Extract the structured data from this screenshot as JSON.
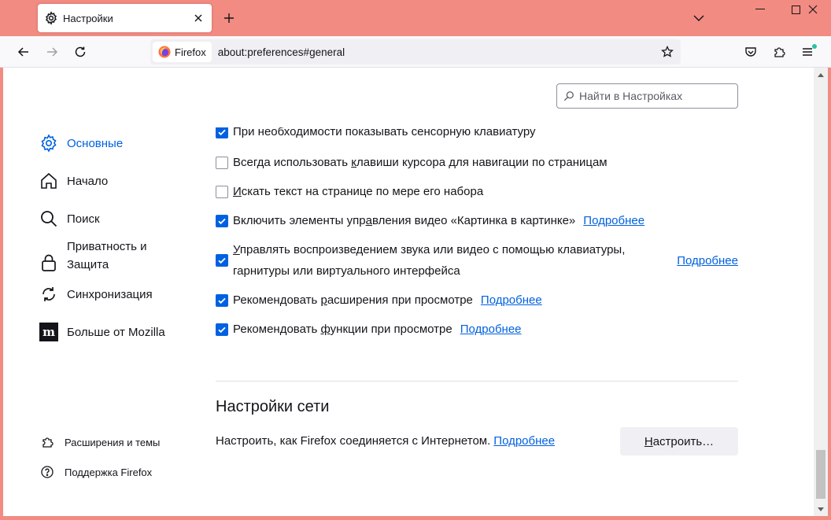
{
  "window": {
    "tab_title": "Настройки",
    "colors": {
      "frame": "#f28b82",
      "accent": "#0061e0"
    }
  },
  "toolbar": {
    "identity_label": "Firefox",
    "url": "about:preferences#general"
  },
  "search": {
    "placeholder": "Найти в Настройках"
  },
  "sidebar": {
    "categories": [
      {
        "label": "Основные",
        "icon": "gear-icon",
        "selected": true
      },
      {
        "label": "Начало",
        "icon": "home-icon"
      },
      {
        "label": "Поиск",
        "icon": "search-icon"
      },
      {
        "label": "Приватность и",
        "label2": "Защита",
        "icon": "lock-icon"
      },
      {
        "label": "Синхронизация",
        "icon": "sync-icon"
      },
      {
        "label": "Больше от Mozilla",
        "icon": "mozilla-icon"
      }
    ],
    "footer": [
      {
        "label": "Расширения и темы",
        "icon": "puzzle-icon"
      },
      {
        "label": "Поддержка Firefox",
        "icon": "help-icon"
      }
    ]
  },
  "options": [
    {
      "pre": "",
      "ak": "",
      "post": "При необходимости показывать сенсорную клавиатуру",
      "checked": true
    },
    {
      "pre": "Всегда использовать ",
      "ak": "к",
      "post": "лавиши курсора для навигации по страницам",
      "checked": false
    },
    {
      "pre": "",
      "ak": "И",
      "post": "скать текст на странице по мере его набора",
      "checked": false
    },
    {
      "pre": "Включить элементы упр",
      "ak": "а",
      "post": "вления видео «Картинка в картинке»",
      "checked": true,
      "link": "Подробнее"
    },
    {
      "pre": "",
      "ak": "У",
      "post": "правлять воспроизведением звука или видео с помощью клавиатуры,",
      "line2": "гарнитуры или виртуального интерфейса",
      "checked": true,
      "link": "Подробнее"
    },
    {
      "pre": "Рекомендовать ",
      "ak": "р",
      "post": "асширения при просмотре",
      "checked": true,
      "link": "Подробнее"
    },
    {
      "pre": "Рекомендовать ",
      "ak": "ф",
      "post": "ункции при просмотре",
      "checked": true,
      "link": "Подробнее"
    }
  ],
  "network": {
    "title": "Настройки сети",
    "description": "Настроить, как Firefox соединяется с Интернетом.",
    "link": "Подробнее",
    "button_ak": "Н",
    "button_rest": "астроить…"
  }
}
